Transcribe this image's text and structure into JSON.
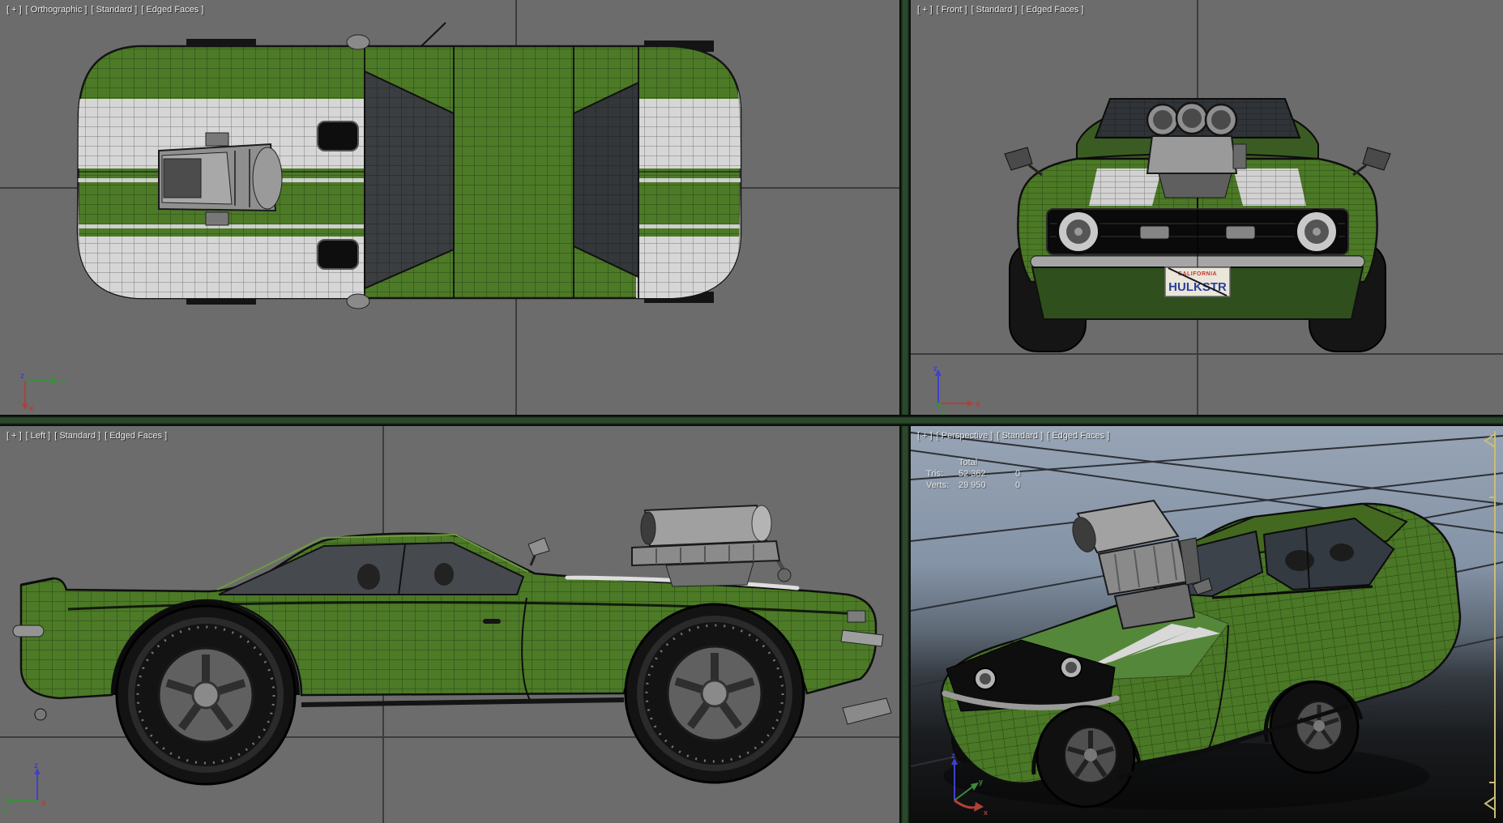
{
  "viewports": {
    "top_left": {
      "segments": {
        "plus": "[ + ]",
        "view": "[ Orthographic ]",
        "style": "[ Standard ]",
        "shading": "[ Edged Faces ]"
      }
    },
    "top_right": {
      "segments": {
        "plus": "[ + ]",
        "view": "[ Front ]",
        "style": "[ Standard ]",
        "shading": "[ Edged Faces ]"
      }
    },
    "bottom_left": {
      "segments": {
        "plus": "[ + ]",
        "view": "[ Left ]",
        "style": "[ Standard ]",
        "shading": "[ Edged Faces ]"
      }
    },
    "bottom_right": {
      "segments": {
        "plus": "[ + ]",
        "view": "[ Perspective ]",
        "style": "[ Standard ]",
        "shading": "[ Edged Faces ]"
      },
      "stats": {
        "header": "Total",
        "rows": [
          {
            "label": "Tris:",
            "total": "52 362",
            "selected": "0"
          },
          {
            "label": "Verts:",
            "total": "29 950",
            "selected": "0"
          }
        ]
      }
    }
  },
  "axes": {
    "x": "x",
    "y": "y",
    "z": "z"
  },
  "license_plate": {
    "header": "CALIFORNIA",
    "text": "HULKSTR"
  },
  "colors": {
    "car_green": "#4c7a27",
    "stripe_white": "#d6d6d6",
    "viewport_gray": "#6c6c6c",
    "separator_green": "#2c482c",
    "sky_top": "#97a4b5",
    "sky_bottom": "#0d0d0d",
    "grid_line": "#3c3c3c",
    "active_widget_yellow": "#c9bd74",
    "plate_blue": "#2b3f9b",
    "plate_red": "#c23b2e",
    "axis_x_red": "#b04038",
    "axis_y_green": "#3d8b3d",
    "axis_z_blue": "#4040cc"
  }
}
